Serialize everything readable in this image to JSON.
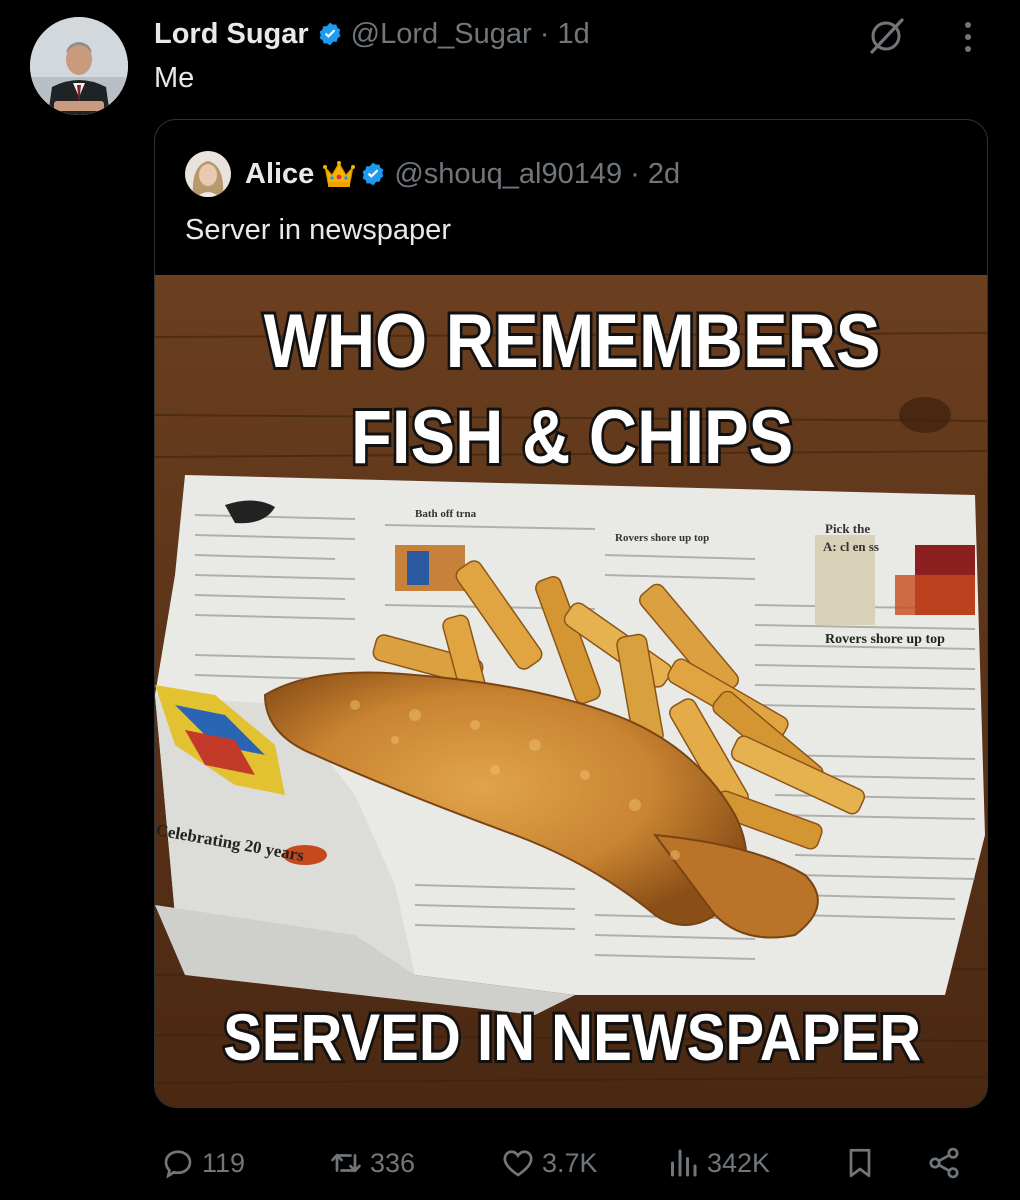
{
  "tweet": {
    "name": "Lord Sugar",
    "handle": "@Lord_Sugar",
    "time": "1d",
    "text": "Me"
  },
  "quoted": {
    "name": "Alice",
    "handle": "@shouq_al90149",
    "time": "2d",
    "text": "Server in newspaper",
    "image": {
      "headline_1": "WHO REMEMBERS",
      "headline_2": "FISH & CHIPS",
      "footer": "SERVED IN NEWSPAPER",
      "paper_1": "Rovers shore up top",
      "paper_2": "Rovers shore up top",
      "paper_3": "Bath off trna",
      "paper_4": "Pick the",
      "paper_5": "A: cl en ss",
      "paper_6": "Celebrating 20 years"
    }
  },
  "actions": {
    "replies": "119",
    "reposts": "336",
    "likes": "3.7K",
    "views": "342K"
  },
  "colors": {
    "background": "#000000",
    "text": "#e7e9ea",
    "muted": "#71767b",
    "verified": "#1d9bf0",
    "border": "#2f3336"
  }
}
